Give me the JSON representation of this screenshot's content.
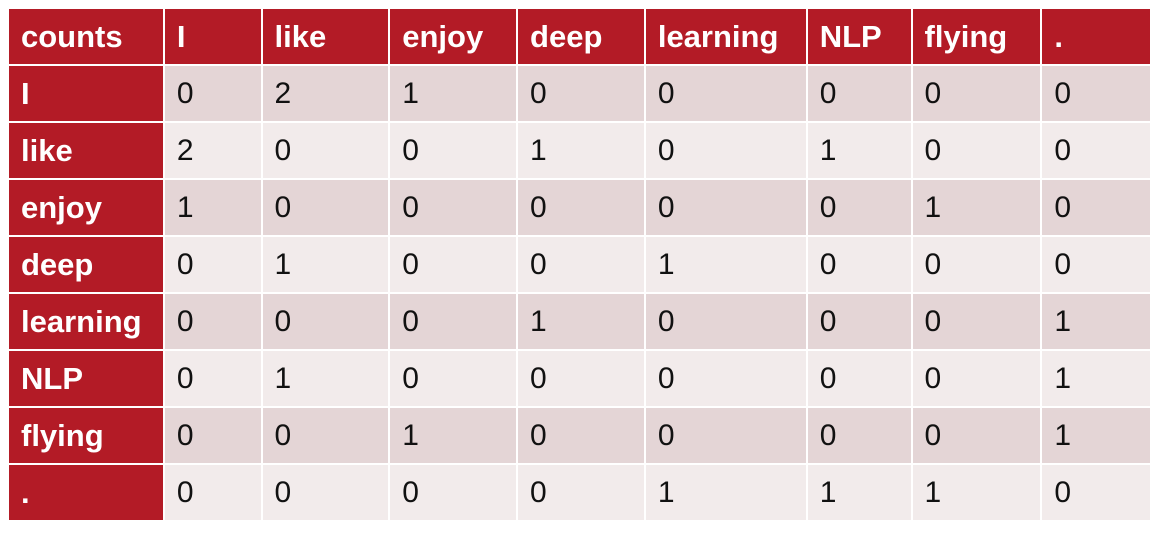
{
  "table": {
    "corner_label": "counts",
    "columns": [
      "I",
      "like",
      "enjoy",
      "deep",
      "learning",
      "NLP",
      "flying",
      "."
    ],
    "rows": [
      {
        "label": "I",
        "values": [
          0,
          2,
          1,
          0,
          0,
          0,
          0,
          0
        ]
      },
      {
        "label": "like",
        "values": [
          2,
          0,
          0,
          1,
          0,
          1,
          0,
          0
        ]
      },
      {
        "label": "enjoy",
        "values": [
          1,
          0,
          0,
          0,
          0,
          0,
          1,
          0
        ]
      },
      {
        "label": "deep",
        "values": [
          0,
          1,
          0,
          0,
          1,
          0,
          0,
          0
        ]
      },
      {
        "label": "learning",
        "values": [
          0,
          0,
          0,
          1,
          0,
          0,
          0,
          1
        ]
      },
      {
        "label": "NLP",
        "values": [
          0,
          1,
          0,
          0,
          0,
          0,
          0,
          1
        ]
      },
      {
        "label": "flying",
        "values": [
          0,
          0,
          1,
          0,
          0,
          0,
          0,
          1
        ]
      },
      {
        "label": ".",
        "values": [
          0,
          0,
          0,
          0,
          1,
          1,
          1,
          0
        ]
      }
    ]
  },
  "colors": {
    "header_bg": "#b31b26",
    "header_text": "#ffffff",
    "row_odd_bg": "#e4d5d6",
    "row_even_bg": "#f2ebeb"
  }
}
